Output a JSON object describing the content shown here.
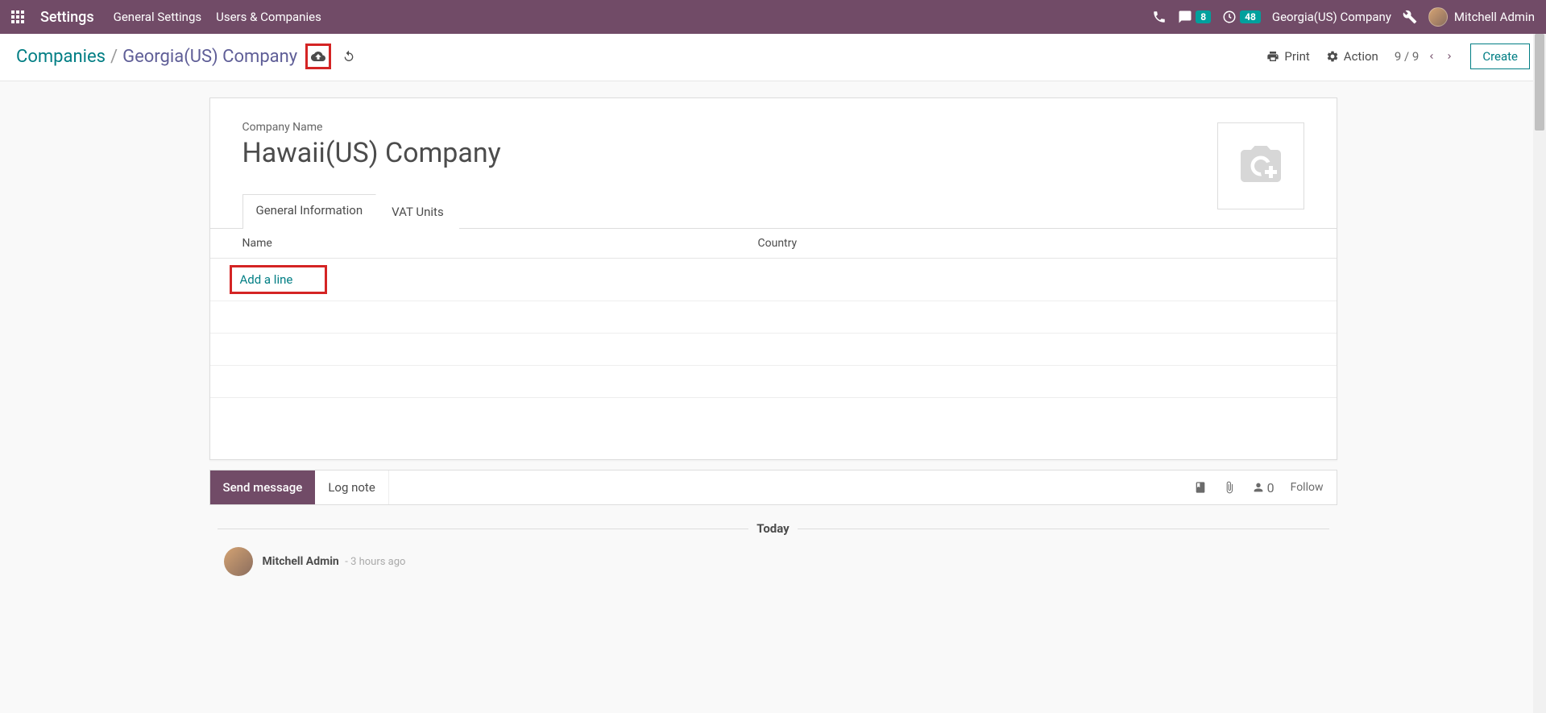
{
  "navbar": {
    "app_name": "Settings",
    "links": {
      "general": "General Settings",
      "users": "Users & Companies"
    },
    "messages_badge": "8",
    "activities_badge": "48",
    "company": "Georgia(US) Company",
    "user": "Mitchell Admin"
  },
  "breadcrumb": {
    "parent": "Companies",
    "current": "Georgia(US) Company"
  },
  "controls": {
    "print": "Print",
    "action": "Action",
    "pager": "9 / 9",
    "create": "Create"
  },
  "form": {
    "company_label": "Company Name",
    "company_value": "Hawaii(US) Company",
    "tabs": {
      "general": "General Information",
      "vat": "VAT Units"
    },
    "columns": {
      "name": "Name",
      "country": "Country"
    },
    "add_line": "Add a line"
  },
  "chatter": {
    "send": "Send message",
    "log": "Log note",
    "followers_count": "0",
    "follow": "Follow",
    "today": "Today",
    "msg_author": "Mitchell Admin",
    "msg_time": "- 3 hours ago"
  }
}
